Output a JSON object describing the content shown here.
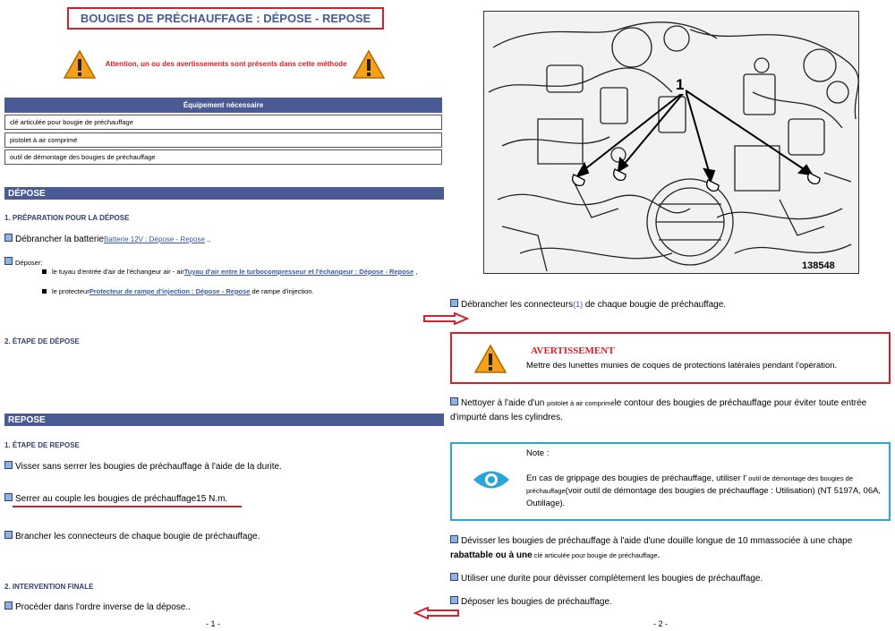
{
  "page1": {
    "title": "BOUGIES DE PRÉCHAUFFAGE : DÉPOSE - REPOSE",
    "warning": "Attention, un ou des avertissements sont présents dans cette méthode",
    "equipment": {
      "header": "Équipement nécessaire",
      "items": [
        "clé articulée pour bougie de préchauffage",
        "pistolet à air comprimé",
        "outil de démontage des bougies de préchauffage"
      ]
    },
    "depose": {
      "header": "DÉPOSE",
      "sub1": "1. PRÉPARATION POUR LA DÉPOSE",
      "step1_text": "Débrancher la batterie",
      "step1_link": "Batterie 12V : Dépose - Repose",
      "step1_suffix": " ..",
      "deposer_label": "Déposer:",
      "deposer_item1_text": "le tuyau d'entrée d'air de l'échangeur air - air",
      "deposer_item1_link": "Tuyau d'air entre le turbocompresseur et l'échangeur : Dépose - Repose",
      "deposer_item1_suffix": " ,",
      "deposer_item2_text": "le protecteur",
      "deposer_item2_link": "Protecteur de rampe d'injection : Dépose - Repose",
      "deposer_item2_suffix": " de rampe d'injection.",
      "sub2": "2. ÉTAPE DE DÉPOSE"
    },
    "repose": {
      "header": "REPOSE",
      "sub1": "1. ÉTAPE DE REPOSE",
      "step1": "Visser sans serrer les bougies de préchauffage à l'aide de la durite.",
      "step2": "Serrer au couple les bougies de préchauffage15  N.m.",
      "step3": "Brancher les connecteurs de chaque bougie de préchauffage.",
      "sub2": "2. INTERVENTION FINALE",
      "step4": "Procéder dans l'ordre inverse de la dépose.."
    },
    "page_number": "- 1 -"
  },
  "page2": {
    "image_callout": "1",
    "image_id": "138548",
    "step_connectors": "Débrancher les connecteurs",
    "step_connectors_ref": "(1)",
    "step_connectors_suffix": " de chaque bougie de préchauffage.",
    "avertissement": {
      "title": "AVERTISSEMENT",
      "text": "Mettre des lunettes munies de coques de protections latérales pendant l'opération."
    },
    "step_clean_a": "Nettoyer à l'aide d'un ",
    "step_clean_tool": "pistolet à air comprimé",
    "step_clean_b": "le contour des bougies de préchauffage pour éviter toute entrée d'impurté dans les cylindres.",
    "note": {
      "label": "Note :",
      "text_a": "En cas de grippage des bougies de préchauffage, utiliser l'",
      "text_tool": " outil de démontage des bougies de préchauffage",
      "text_b": "(voir outil de démontage des bougies de préchauffage : Utilisation) (NT 5197A, 06A, Outillage)."
    },
    "step_unscrew_a": "Dévisser les bougies de préchauffage à l'aide d'une douille longue de 10  mmassociée à une chape ",
    "step_unscrew_b": "rabattable ou à une",
    "step_unscrew_tool": " clé articulée pour bougie de préchauffage",
    "step_unscrew_c": ".",
    "step_durite": "Utiliser une durite pour dévisser complètement les bougies de préchauffage.",
    "step_deposer": "Déposer les bougies de préchauffage.",
    "page_number": "- 2 -"
  },
  "colors": {
    "accent_blue": "#4a5a94",
    "warning_red": "#d6202a",
    "note_blue": "#2aa6d6",
    "link_blue": "#3b5aa3"
  }
}
